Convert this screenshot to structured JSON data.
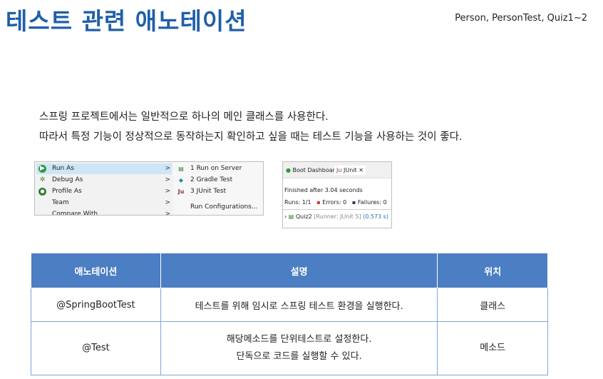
{
  "header": {
    "title": "테스트 관련 애노테이션",
    "subtitle": "Person, PersonTest, Quiz1~2"
  },
  "body": {
    "line1": "스프링 프로젝트에서는 일반적으로 하나의 메인 클래스를 사용한다.",
    "line2": "따라서 특정 기능이 정상적으로 동작하는지 확인하고 싶을 때는 테스트 기능을 사용하는 것이 좋다."
  },
  "context_menu": {
    "items": [
      {
        "label": "Run As",
        "icon": "run-icon",
        "arrow": ">"
      },
      {
        "label": "Debug As",
        "icon": "debug-icon",
        "arrow": ">"
      },
      {
        "label": "Profile As",
        "icon": "profile-icon",
        "arrow": ">"
      },
      {
        "label": "Team",
        "icon": "",
        "arrow": ">"
      },
      {
        "label": "Compare With",
        "icon": "",
        "arrow": ">"
      }
    ],
    "submenu": [
      {
        "label": "1 Run on Server",
        "icon": "server-icon"
      },
      {
        "label": "2 Gradle Test",
        "icon": "gradle-icon"
      },
      {
        "label": "3 JUnit Test",
        "icon": "junit-icon"
      },
      {
        "label": "Run Configurations...",
        "icon": ""
      }
    ]
  },
  "junit_panel": {
    "tab1": "Boot Dashboard",
    "tab2": "JUnit",
    "close": "✕",
    "finished": "Finished after 3.04 seconds",
    "runs_label": "Runs:",
    "runs_value": "1/1",
    "errors_label": "Errors:",
    "errors_value": "0",
    "failures_label": "Failures:",
    "failures_value": "0",
    "test_name": "Quiz2",
    "test_runner": "[Runner: JUnit 5]",
    "test_time": "(0.573 s)"
  },
  "table": {
    "headers": [
      "애노테이션",
      "설명",
      "위치"
    ],
    "rows": [
      {
        "annotation": "@SpringBootTest",
        "desc1": "테스트를 위해 임시로 스프링 테스트 환경을 실행한다.",
        "desc2": "",
        "location": "클래스"
      },
      {
        "annotation": "@Test",
        "desc1": "해당메소드를 단위테스트로 설정한다.",
        "desc2": "단독으로 코드를 실행할 수 있다.",
        "location": "메소드"
      }
    ]
  },
  "colors": {
    "title": "#1f5fa8",
    "table_header_bg": "#4b7ec2",
    "table_border": "#7ea6d8",
    "menu_highlight": "#cde6f7"
  }
}
